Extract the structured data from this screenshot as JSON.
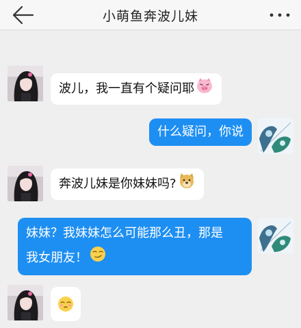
{
  "header": {
    "title": "小萌鱼奔波儿妹"
  },
  "messages": [
    {
      "side": "in",
      "text": "波儿，我一直有个疑问耶",
      "emoji": "pink-pig-face-icon"
    },
    {
      "side": "out",
      "text": "什么疑问，你说"
    },
    {
      "side": "in",
      "text": "奔波儿妹是你妹妹吗?",
      "emoji": "doge-dog-face-icon"
    },
    {
      "side": "out",
      "lines": [
        "妹妹？我妹妹怎么可能那么丑，那是",
        "我女朋友！"
      ],
      "emoji": "smirk-face-icon"
    },
    {
      "side": "in",
      "text": "",
      "emoji": "shy-kiss-face-icon"
    }
  ],
  "colors": {
    "background": "#efefef",
    "header": "#f7f7f7",
    "outgoing_bubble": "#1e8ff2",
    "incoming_bubble": "#ffffff"
  }
}
